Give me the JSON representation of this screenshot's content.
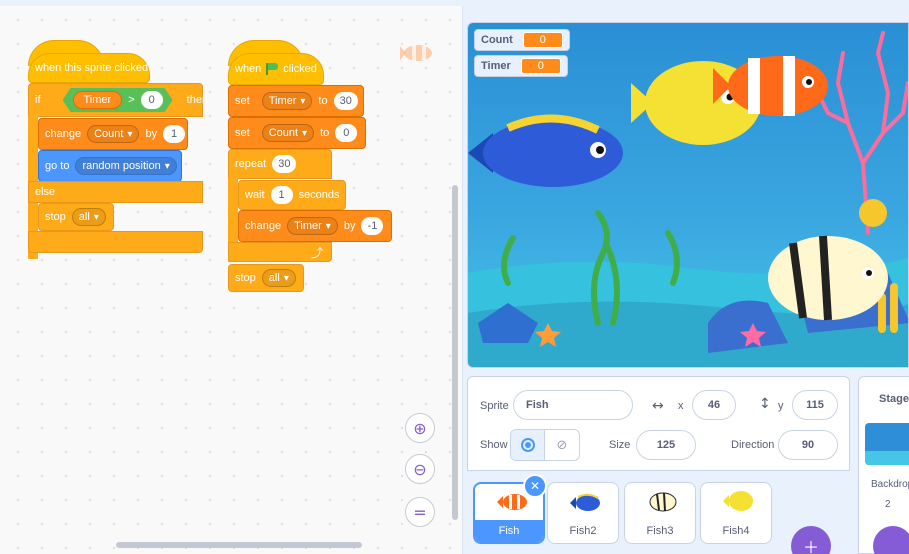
{
  "colors": {
    "events": "#ffbf00",
    "control": "#ffab19",
    "variables": "#ff8c1a",
    "motion": "#4c97ff",
    "operators": "#59c059",
    "accent": "#855cd6"
  },
  "script1": {
    "hat_label": "when this sprite clicked",
    "if_label": "if",
    "then_label": "then",
    "cond_var": "Timer",
    "cond_op": ">",
    "cond_value": "0",
    "change_label": "change",
    "change_var": "Count",
    "change_by": "by",
    "change_value": "1",
    "goto_label": "go to",
    "goto_target": "random position",
    "else_label": "else",
    "stop_label": "stop",
    "stop_option": "all"
  },
  "script2": {
    "hat_when": "when",
    "hat_clicked": "clicked",
    "set1_label": "set",
    "set1_var": "Timer",
    "set1_to": "to",
    "set1_value": "30",
    "set2_label": "set",
    "set2_var": "Count",
    "set2_to": "to",
    "set2_value": "0",
    "repeat_label": "repeat",
    "repeat_value": "30",
    "wait_label": "wait",
    "wait_value": "1",
    "wait_unit": "seconds",
    "change_label": "change",
    "change_var": "Timer",
    "change_by": "by",
    "change_value": "-1",
    "loop_arrow": "⤴",
    "stop_label": "stop",
    "stop_option": "all"
  },
  "zoom": {
    "in_icon": "zoom-in-icon",
    "out_icon": "zoom-out-icon",
    "reset_icon": "zoom-reset-icon",
    "in_glyph": "⊕",
    "out_glyph": "⊖",
    "reset_glyph": "="
  },
  "monitors": [
    {
      "name": "Count",
      "value": "0"
    },
    {
      "name": "Timer",
      "value": "0"
    }
  ],
  "sprite_info": {
    "sprite_label": "Sprite",
    "sprite_name": "Fish",
    "x_label": "x",
    "x_value": "46",
    "y_label": "y",
    "y_value": "115",
    "show_label": "Show",
    "size_label": "Size",
    "size_value": "125",
    "direction_label": "Direction",
    "direction_value": "90"
  },
  "sprites": [
    {
      "name": "Fish",
      "selected": true
    },
    {
      "name": "Fish2",
      "selected": false
    },
    {
      "name": "Fish3",
      "selected": false
    },
    {
      "name": "Fish4",
      "selected": false
    }
  ],
  "stage_panel": {
    "title": "Stage",
    "backdrops_label": "Backdrop",
    "backdrops_count": "2"
  }
}
